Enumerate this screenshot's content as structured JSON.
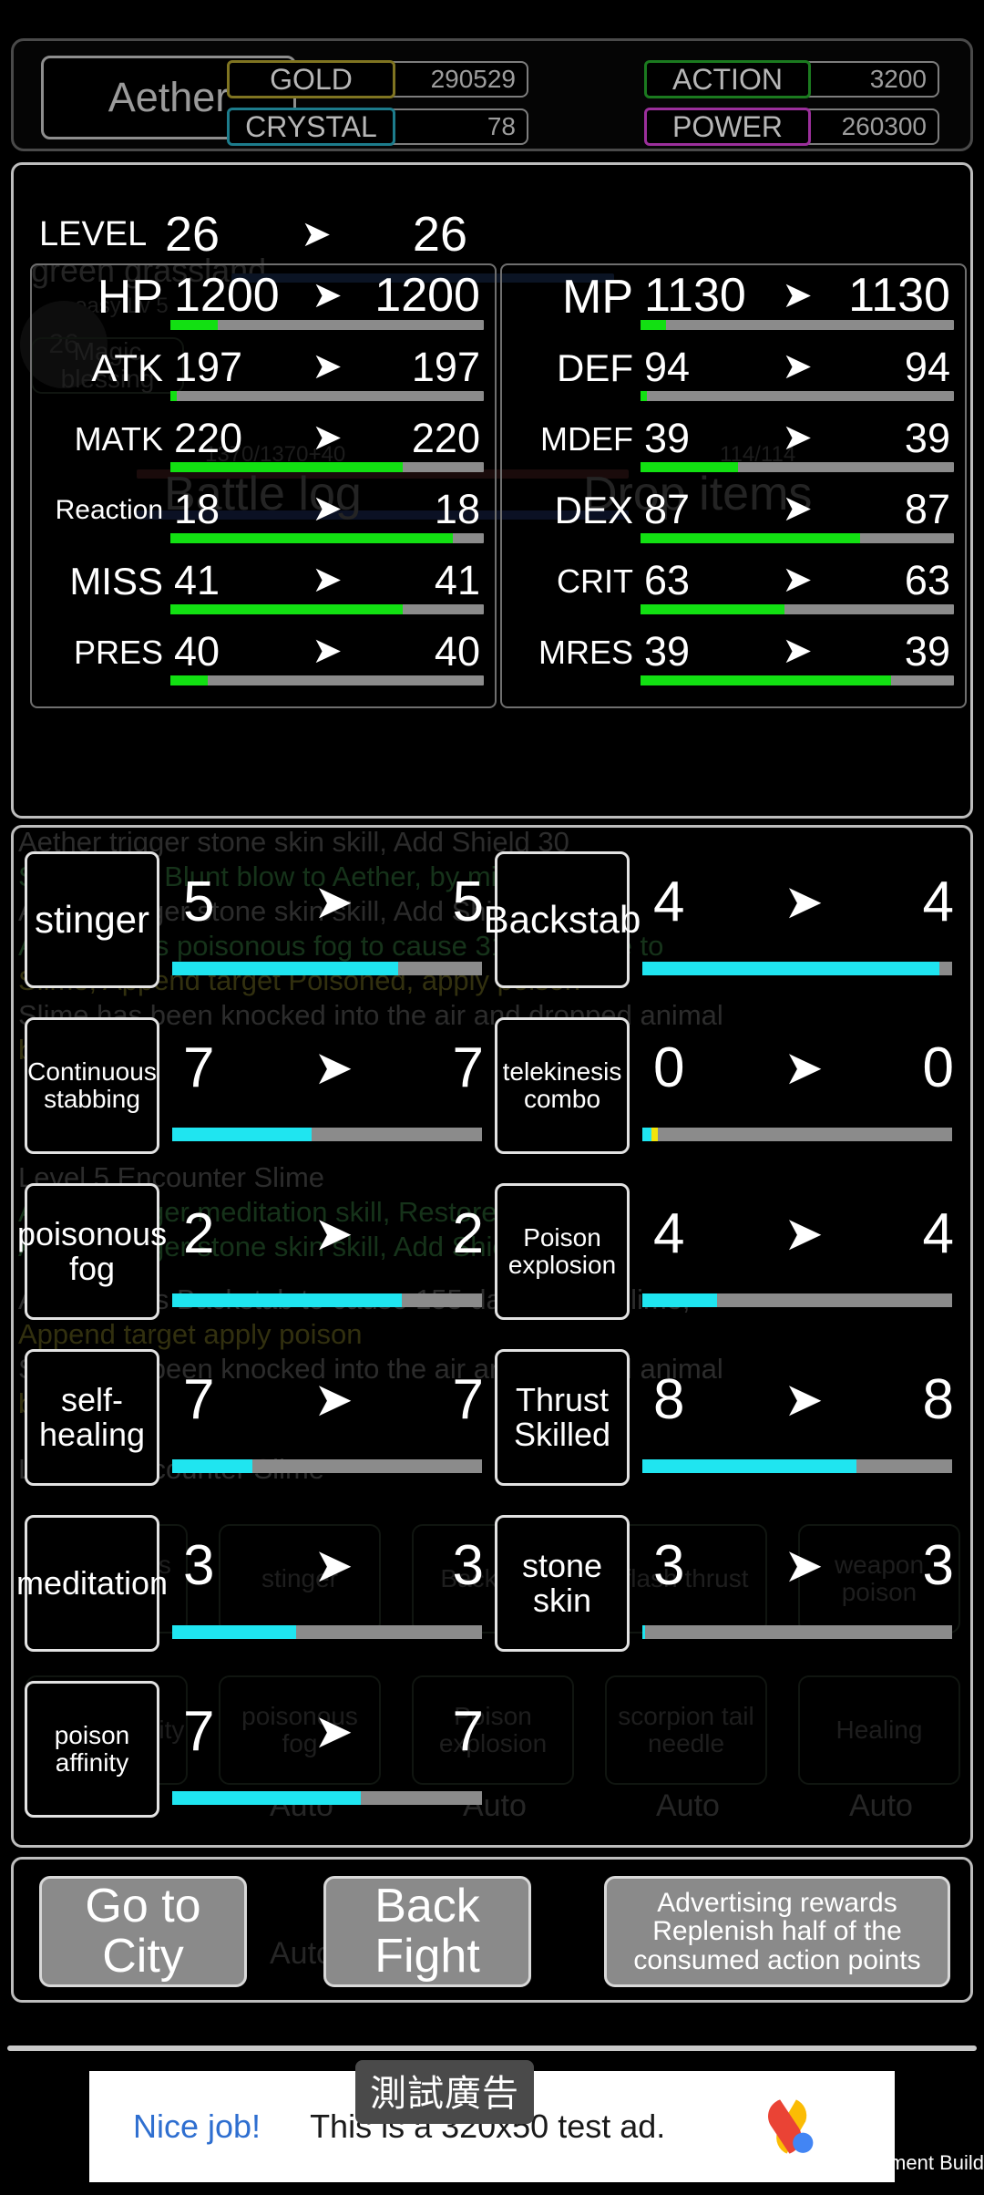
{
  "header": {
    "player_name": "Aether",
    "resources": [
      {
        "key": "gold",
        "label": "GOLD",
        "value": "290529",
        "color": "#7f7421"
      },
      {
        "key": "crystal",
        "label": "CRYSTAL",
        "value": "78",
        "color": "#1d7c8c"
      },
      {
        "key": "action",
        "label": "ACTION",
        "value": "3200",
        "color": "#1b7a1f"
      },
      {
        "key": "power",
        "label": "POWER",
        "value": "260300",
        "color": "#9b2f9b"
      }
    ]
  },
  "stats": {
    "level": {
      "label": "LEVEL",
      "before": "26",
      "after": "26"
    },
    "arrow": "➤",
    "left": [
      {
        "label": "HP",
        "before": "1200",
        "after": "1200",
        "fill": 15
      },
      {
        "label": "ATK",
        "before": "197",
        "after": "197",
        "fill": 2
      },
      {
        "label": "MATK",
        "before": "220",
        "after": "220",
        "fill": 74
      },
      {
        "label": "Reaction",
        "before": "18",
        "after": "18",
        "fill": 90
      },
      {
        "label": "MISS",
        "before": "41",
        "after": "41",
        "fill": 74
      },
      {
        "label": "PRES",
        "before": "40",
        "after": "40",
        "fill": 12
      }
    ],
    "right": [
      {
        "label": "MP",
        "before": "1130",
        "after": "1130",
        "fill": 8
      },
      {
        "label": "DEF",
        "before": "94",
        "after": "94",
        "fill": 2
      },
      {
        "label": "MDEF",
        "before": "39",
        "after": "39",
        "fill": 31
      },
      {
        "label": "DEX",
        "before": "87",
        "after": "87",
        "fill": 70
      },
      {
        "label": "CRIT",
        "before": "63",
        "after": "63",
        "fill": 46
      },
      {
        "label": "MRES",
        "before": "39",
        "after": "39",
        "fill": 80
      }
    ]
  },
  "skills": [
    {
      "name": "stinger",
      "before": "5",
      "after": "5",
      "cyan": 73,
      "yellow": 0
    },
    {
      "name": "Backstab",
      "before": "4",
      "after": "4",
      "cyan": 96,
      "yellow": 0
    },
    {
      "name": "Continuous stabbing",
      "before": "7",
      "after": "7",
      "cyan": 45,
      "yellow": 0
    },
    {
      "name": "telekinesis combo",
      "before": "0",
      "after": "0",
      "cyan": 3,
      "yellow": 2
    },
    {
      "name": "poisonous fog",
      "before": "2",
      "after": "2",
      "cyan": 74,
      "yellow": 0
    },
    {
      "name": "Poison explosion",
      "before": "4",
      "after": "4",
      "cyan": 24,
      "yellow": 0
    },
    {
      "name": "self-healing",
      "before": "7",
      "after": "7",
      "cyan": 26,
      "yellow": 0
    },
    {
      "name": "Thrust Skilled",
      "before": "8",
      "after": "8",
      "cyan": 69,
      "yellow": 0
    },
    {
      "name": "meditation",
      "before": "3",
      "after": "3",
      "cyan": 40,
      "yellow": 0
    },
    {
      "name": "stone skin",
      "before": "3",
      "after": "3",
      "cyan": 1,
      "yellow": 0
    },
    {
      "name": "poison affinity",
      "before": "7",
      "after": "7",
      "cyan": 61,
      "yellow": 0
    }
  ],
  "actions": {
    "go_to_city": "Go to\nCity",
    "back_fight": "Back\nFight",
    "ad_reward": "Advertising rewards\nReplenish half of the\nconsumed action points"
  },
  "ad": {
    "badge": "測試廣告",
    "nice": "Nice job!",
    "text": "This is a 320x50 test ad.",
    "dev_build": "velopment Build"
  },
  "background": {
    "stage_title": "green grassland",
    "stage_sub": "easy Lv 5",
    "hp_readout": "1370/1370+40",
    "mp_readout": "114/114",
    "battle_log_title": "Battle log",
    "drop_items_title": "Drop items",
    "blessing_label": "Magic blessing",
    "player_badge": "26",
    "log_lines": [
      "Aether trigger stone skin skill, Add Shield 30",
      "Slime uses Blunt blow to Aether, by miss",
      "Aether trigger stone skin skill, Add Shield 30",
      "Aether uses poisonous fog to cause 313 damage to",
      "Slime, Append target Poisoned, apply poison",
      "Slime has been knocked into the air and dropped animal",
      "bones",
      "Level 5 Encounter Slime",
      "Aether trigger meditation skill, Restore MP 60",
      "Aether trigger stone skin skill, Add Shield 30",
      "Aether uses Backstab to cause 155 damage to Slime,",
      "Append target apply poison",
      "Slime has been knocked into the air and dropped animal",
      "bones",
      "Level 5 Encounter Slime"
    ],
    "skill_slots": [
      "Continuous stabbing",
      "stinger",
      "Backstab",
      "flash thrust",
      "weapon poison",
      "poison affinity",
      "poisonous fog",
      "Poison explosion",
      "scorpion tail needle",
      "Healing"
    ],
    "auto_label": "Auto"
  }
}
